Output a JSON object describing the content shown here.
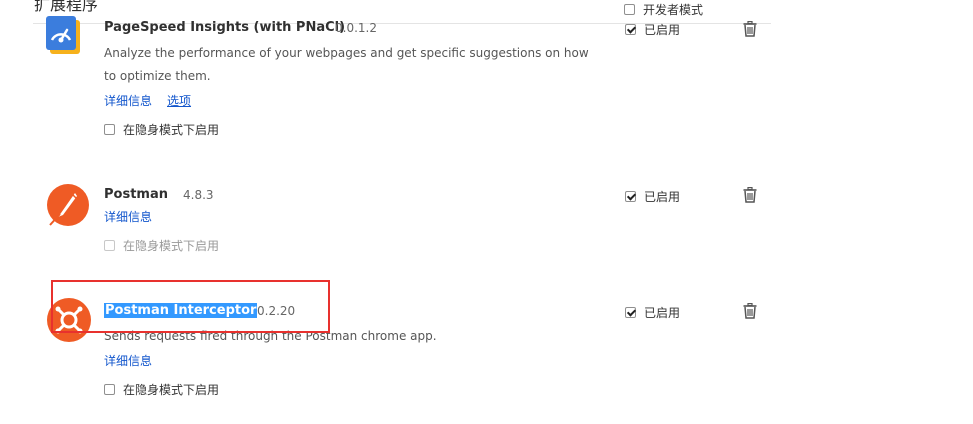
{
  "header": {
    "title": "扩展程序",
    "developer_mode_label": "开发者模式"
  },
  "extensions": [
    {
      "name": "PageSpeed Insights (with PNaCl)",
      "version": "0.0.1.2",
      "description": "Analyze the performance of your webpages and get specific suggestions on how to optimize them.",
      "details_link": "详细信息",
      "options_link": "选项",
      "incognito_label": "在隐身模式下启用",
      "enabled_label": "已启用"
    },
    {
      "name": "Postman",
      "version": "4.8.3",
      "details_link": "详细信息",
      "incognito_label": "在隐身模式下启用",
      "enabled_label": "已启用"
    },
    {
      "name": "Postman Interceptor",
      "version": "0.2.20",
      "description": "Sends requests fired through the Postman chrome app.",
      "details_link": "详细信息",
      "incognito_label": "在隐身模式下启用",
      "enabled_label": "已启用"
    }
  ],
  "colors": {
    "link": "#1155cc",
    "postman_orange": "#ef5b25",
    "highlight_box": "#e8312e",
    "selection": "#3399ff"
  }
}
